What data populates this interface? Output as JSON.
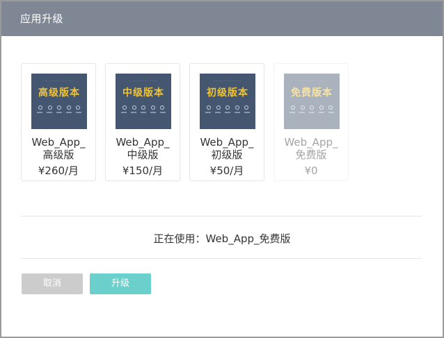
{
  "dialog": {
    "title": "应用升级"
  },
  "plans": [
    {
      "badge": "高级版本",
      "name_line1": "Web_App_",
      "name_line2": "高级版",
      "price": "¥260/月",
      "disabled": false
    },
    {
      "badge": "中级版本",
      "name_line1": "Web_App_",
      "name_line2": "中级版",
      "price": "¥150/月",
      "disabled": false
    },
    {
      "badge": "初级版本",
      "name_line1": "Web_App_",
      "name_line2": "初级版",
      "price": "¥50/月",
      "disabled": false
    },
    {
      "badge": "免费版本",
      "name_line1": "Web_App_",
      "name_line2": "免费版",
      "price": "¥0",
      "disabled": true
    }
  ],
  "current": {
    "text": "正在使用：Web_App_免费版"
  },
  "buttons": {
    "cancel_label": "取消",
    "upgrade_label": "升级"
  },
  "colors": {
    "titlebar": "#7f8795",
    "cancel": "#cccccc",
    "upgrade": "#6bcfcc",
    "thumb_bg": "#455770",
    "badge_text": "#f1c232"
  }
}
